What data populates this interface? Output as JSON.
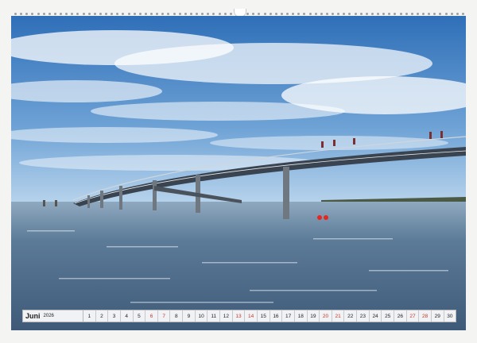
{
  "calendar": {
    "month": "Juni",
    "year": "2026",
    "days": [
      {
        "n": "1",
        "we": false
      },
      {
        "n": "2",
        "we": false
      },
      {
        "n": "3",
        "we": false
      },
      {
        "n": "4",
        "we": false
      },
      {
        "n": "5",
        "we": false
      },
      {
        "n": "6",
        "we": true
      },
      {
        "n": "7",
        "we": true
      },
      {
        "n": "8",
        "we": false
      },
      {
        "n": "9",
        "we": false
      },
      {
        "n": "10",
        "we": false
      },
      {
        "n": "11",
        "we": false
      },
      {
        "n": "12",
        "we": false
      },
      {
        "n": "13",
        "we": true
      },
      {
        "n": "14",
        "we": true
      },
      {
        "n": "15",
        "we": false
      },
      {
        "n": "16",
        "we": false
      },
      {
        "n": "17",
        "we": false
      },
      {
        "n": "18",
        "we": false
      },
      {
        "n": "19",
        "we": false
      },
      {
        "n": "20",
        "we": true
      },
      {
        "n": "21",
        "we": true
      },
      {
        "n": "22",
        "we": false
      },
      {
        "n": "23",
        "we": false
      },
      {
        "n": "24",
        "we": false
      },
      {
        "n": "25",
        "we": false
      },
      {
        "n": "26",
        "we": false
      },
      {
        "n": "27",
        "we": true
      },
      {
        "n": "28",
        "we": true
      },
      {
        "n": "29",
        "we": false
      },
      {
        "n": "30",
        "we": false
      }
    ]
  },
  "colors": {
    "sky_top": "#2f6fb8",
    "sky_bottom": "#a9cbe8",
    "sea": "#4f6f90",
    "weekend": "#c0392b"
  }
}
